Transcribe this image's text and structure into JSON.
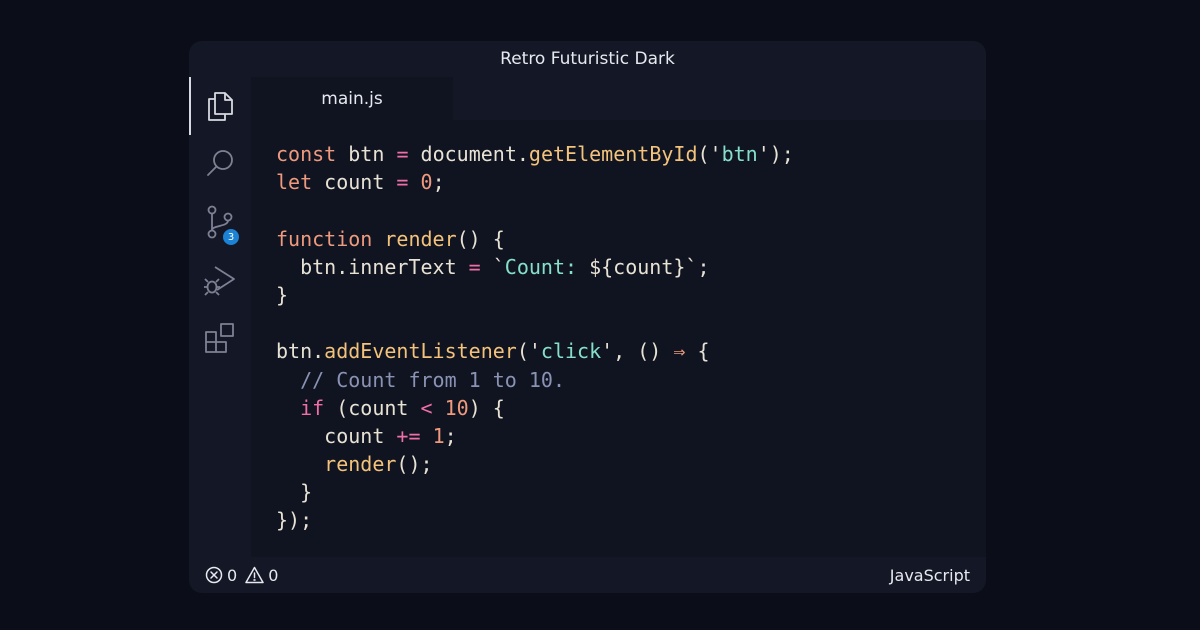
{
  "window": {
    "title": "Retro Futuristic Dark"
  },
  "activity_bar": {
    "items": [
      {
        "name": "explorer",
        "icon": "files-icon",
        "active": true
      },
      {
        "name": "search",
        "icon": "search-icon"
      },
      {
        "name": "source-control",
        "icon": "source-control-icon",
        "badge": "3"
      },
      {
        "name": "run-debug",
        "icon": "run-debug-icon"
      },
      {
        "name": "extensions",
        "icon": "extensions-icon"
      }
    ]
  },
  "tabs": [
    {
      "label": "main.js",
      "active": true
    }
  ],
  "code_lines": [
    [
      {
        "t": "const",
        "c": "kw"
      },
      {
        "t": " btn "
      },
      {
        "t": "=",
        "c": "op"
      },
      {
        "t": " document."
      },
      {
        "t": "getElementById",
        "c": "fn"
      },
      {
        "t": "('"
      },
      {
        "t": "btn",
        "c": "str"
      },
      {
        "t": "');"
      }
    ],
    [
      {
        "t": "let",
        "c": "kw"
      },
      {
        "t": " count "
      },
      {
        "t": "=",
        "c": "op"
      },
      {
        "t": " "
      },
      {
        "t": "0",
        "c": "num"
      },
      {
        "t": ";"
      }
    ],
    [],
    [
      {
        "t": "function",
        "c": "kw"
      },
      {
        "t": " "
      },
      {
        "t": "render",
        "c": "fn"
      },
      {
        "t": "() {"
      }
    ],
    [
      {
        "t": "  btn.innerText "
      },
      {
        "t": "=",
        "c": "op"
      },
      {
        "t": " `"
      },
      {
        "t": "Count: ",
        "c": "str"
      },
      {
        "t": "${count}"
      },
      {
        "t": "`;"
      }
    ],
    [
      {
        "t": "}"
      }
    ],
    [],
    [
      {
        "t": "btn."
      },
      {
        "t": "addEventListener",
        "c": "fn"
      },
      {
        "t": "('"
      },
      {
        "t": "click",
        "c": "str"
      },
      {
        "t": "', () "
      },
      {
        "t": "⇒",
        "c": "arrow"
      },
      {
        "t": " {"
      }
    ],
    [
      {
        "t": "  "
      },
      {
        "t": "// Count from 1 to 10.",
        "c": "cmt"
      }
    ],
    [
      {
        "t": "  "
      },
      {
        "t": "if",
        "c": "ctl"
      },
      {
        "t": " (count "
      },
      {
        "t": "<",
        "c": "op"
      },
      {
        "t": " "
      },
      {
        "t": "10",
        "c": "num"
      },
      {
        "t": ") {"
      }
    ],
    [
      {
        "t": "    count "
      },
      {
        "t": "+=",
        "c": "op"
      },
      {
        "t": " "
      },
      {
        "t": "1",
        "c": "num"
      },
      {
        "t": ";"
      }
    ],
    [
      {
        "t": "    "
      },
      {
        "t": "render",
        "c": "fn"
      },
      {
        "t": "();"
      }
    ],
    [
      {
        "t": "  }"
      }
    ],
    [
      {
        "t": "});"
      }
    ]
  ],
  "status_bar": {
    "errors": "0",
    "warnings": "0",
    "language": "JavaScript"
  },
  "colors": {
    "background": "#0b0e18",
    "window": "#141826",
    "editor": "#101421",
    "badge": "#1b82d4",
    "keyword": "#ef9a7e",
    "function": "#f3c27b",
    "string": "#86e0c9",
    "operator": "#f06fa6",
    "comment": "#8a93b4"
  }
}
